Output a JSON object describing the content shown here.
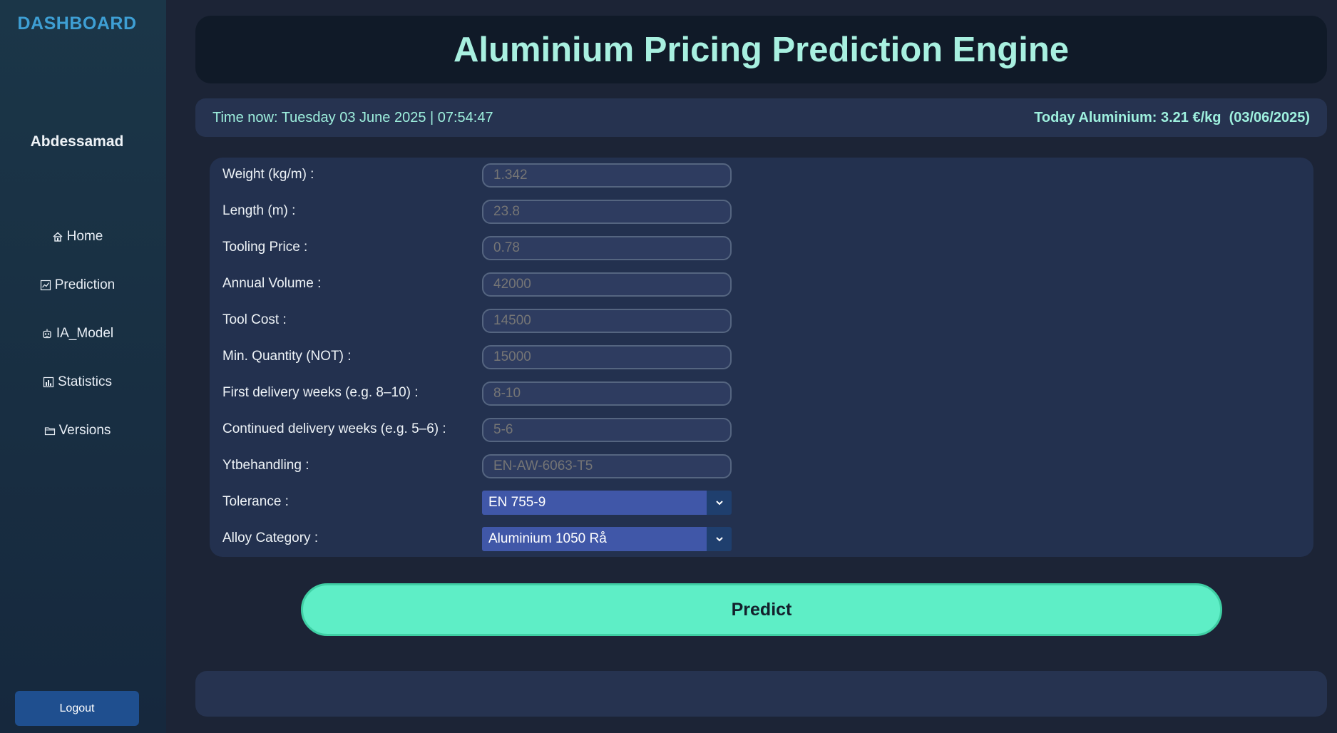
{
  "sidebar": {
    "brand": "DASHBOARD",
    "username": "Abdessamad",
    "items": [
      {
        "label": "Home",
        "icon": "house-icon"
      },
      {
        "label": "Prediction",
        "icon": "chart-icon"
      },
      {
        "label": " IA_Model",
        "icon": "robot-icon"
      },
      {
        "label": "Statistics",
        "icon": "bar-chart-icon"
      },
      {
        "label": "Versions",
        "icon": "folder-icon"
      }
    ],
    "logout_label": "Logout"
  },
  "header": {
    "title": "Aluminium Pricing Prediction Engine"
  },
  "info": {
    "time_now": "Time now: Tuesday 03 June 2025 | 07:54:47",
    "today_price": "Today Aluminium: 3.21 €/kg  (03/06/2025)"
  },
  "form": {
    "fields": [
      {
        "label": "Weight (kg/m) :",
        "placeholder": "1.342"
      },
      {
        "label": "Length (m) :",
        "placeholder": "23.8"
      },
      {
        "label": "Tooling Price :",
        "placeholder": "0.78"
      },
      {
        "label": "Annual Volume :",
        "placeholder": "42000"
      },
      {
        "label": "Tool Cost :",
        "placeholder": "14500"
      },
      {
        "label": "Min. Quantity (NOT) :",
        "placeholder": "15000"
      },
      {
        "label": "First delivery weeks (e.g. 8–10) :",
        "placeholder": "8-10"
      },
      {
        "label": "Continued delivery weeks (e.g. 5–6) :",
        "placeholder": "5-6"
      },
      {
        "label": "Ytbehandling :",
        "placeholder": "EN-AW-6063-T5"
      }
    ],
    "selects": [
      {
        "label": "Tolerance :",
        "value": "EN 755-9"
      },
      {
        "label": "Alloy Category :",
        "value": "Aluminium 1050 Rå"
      }
    ]
  },
  "predict_label": "Predict",
  "colors": {
    "accent": "#5eeec6",
    "title": "#a8f0e0",
    "brand": "#3e9fd4",
    "select": "#4057a8"
  }
}
